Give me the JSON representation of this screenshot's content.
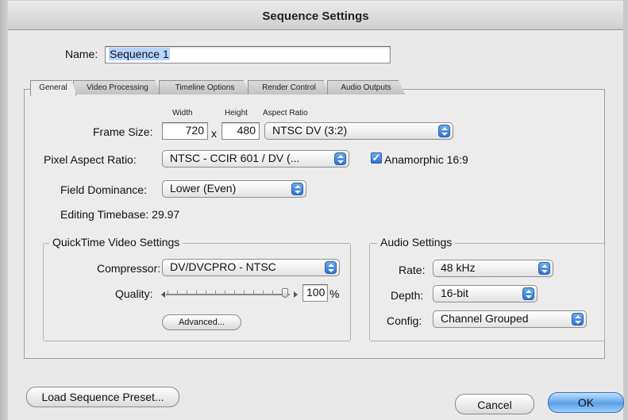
{
  "window": {
    "title": "Sequence Settings"
  },
  "name_row": {
    "label": "Name:",
    "value": "Sequence 1"
  },
  "tabs": [
    {
      "label": "General",
      "active": true
    },
    {
      "label": "Video Processing",
      "active": false
    },
    {
      "label": "Timeline Options",
      "active": false
    },
    {
      "label": "Render Control",
      "active": false
    },
    {
      "label": "Audio Outputs",
      "active": false
    }
  ],
  "general": {
    "frame_size": {
      "label": "Frame Size:",
      "width_header": "Width",
      "height_header": "Height",
      "aspect_header": "Aspect Ratio",
      "width": "720",
      "x_sep": "x",
      "height": "480",
      "aspect_ratio": "NTSC DV (3:2)"
    },
    "pixel_aspect": {
      "label": "Pixel Aspect Ratio:",
      "value": "NTSC - CCIR 601 / DV (..."
    },
    "anamorphic": {
      "label": "Anamorphic 16:9",
      "checked": true,
      "check_glyph": "✓"
    },
    "field_dominance": {
      "label": "Field Dominance:",
      "value": "Lower (Even)"
    },
    "editing_timebase": {
      "text": "Editing Timebase: 29.97"
    }
  },
  "quicktime": {
    "title": "QuickTime Video Settings",
    "compressor_label": "Compressor:",
    "compressor_value": "DV/DVCPRO - NTSC",
    "quality_label": "Quality:",
    "quality_value": "100",
    "quality_unit": "%",
    "quality_fraction": 1.0,
    "advanced_label": "Advanced..."
  },
  "audio": {
    "title": "Audio Settings",
    "rate_label": "Rate:",
    "rate_value": "48 kHz",
    "depth_label": "Depth:",
    "depth_value": "16-bit",
    "config_label": "Config:",
    "config_value": "Channel Grouped"
  },
  "footer": {
    "load_preset_label": "Load Sequence Preset...",
    "cancel_label": "Cancel",
    "ok_label": "OK"
  }
}
